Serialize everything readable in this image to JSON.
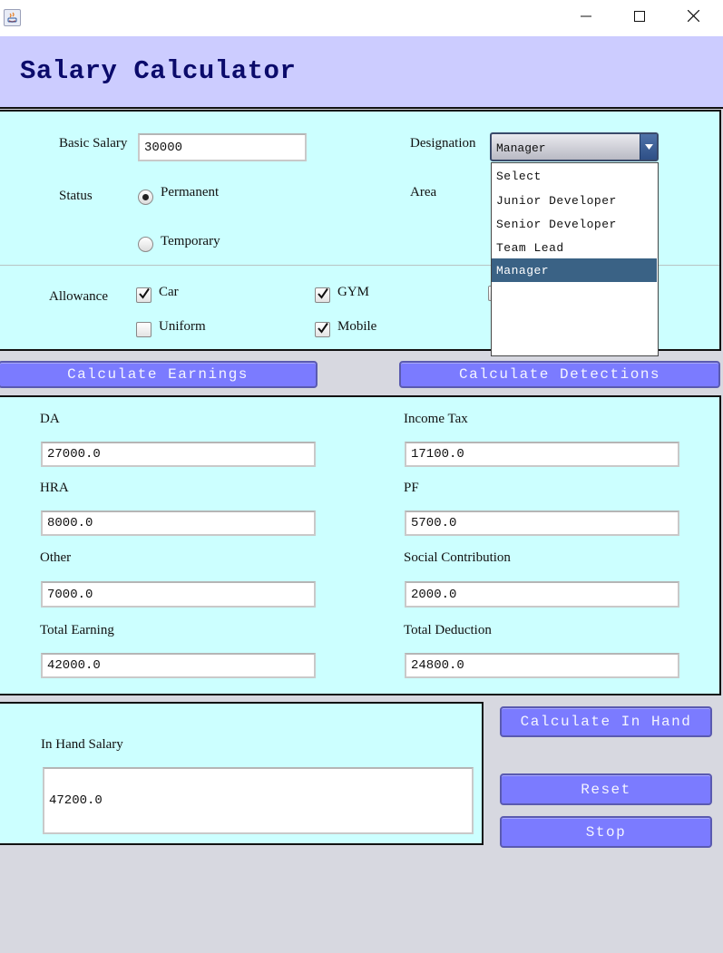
{
  "app": {
    "title": "Salary Calculator"
  },
  "window": {
    "minimize_icon": "minimize-icon",
    "maximize_icon": "maximize-icon",
    "close_icon": "close-icon"
  },
  "top_form": {
    "basic_salary_label": "Basic Salary",
    "basic_salary_value": "30000",
    "designation_label": "Designation",
    "designation_selected": "Manager",
    "designation_options": [
      "Select",
      "Junior Developer",
      "Senior Developer",
      "Team Lead",
      "Manager"
    ],
    "status_label": "Status",
    "status_permanent": "Permanent",
    "status_temporary": "Temporary",
    "status_selected": "Permanent",
    "area_label": "Area"
  },
  "allowance": {
    "label": "Allowance",
    "car": {
      "label": "Car",
      "checked": true
    },
    "gym": {
      "label": "GYM",
      "checked": true
    },
    "uniform": {
      "label": "Uniform",
      "checked": false
    },
    "mobile": {
      "label": "Mobile",
      "checked": true
    }
  },
  "buttons": {
    "calc_earnings": "Calculate Earnings",
    "calc_deductions": "Calculate Detections",
    "calc_in_hand": "Calculate In Hand",
    "reset": "Reset",
    "stop": "Stop"
  },
  "earnings": {
    "da_label": "DA",
    "da_value": "27000.0",
    "hra_label": "HRA",
    "hra_value": "8000.0",
    "other_label": "Other",
    "other_value": "7000.0",
    "total_label": "Total Earning",
    "total_value": "42000.0"
  },
  "deductions": {
    "income_tax_label": "Income Tax",
    "income_tax_value": "17100.0",
    "pf_label": "PF",
    "pf_value": "5700.0",
    "social_label": "Social Contribution",
    "social_value": "2000.0",
    "total_label": "Total Deduction",
    "total_value": "24800.0"
  },
  "in_hand": {
    "label": "In Hand Salary",
    "value": "47200.0"
  },
  "colors": {
    "header_bg": "#ccccff",
    "panel_bg": "#ccffff",
    "button_bg": "#7b7bff",
    "selected_item": "#3a6285"
  }
}
